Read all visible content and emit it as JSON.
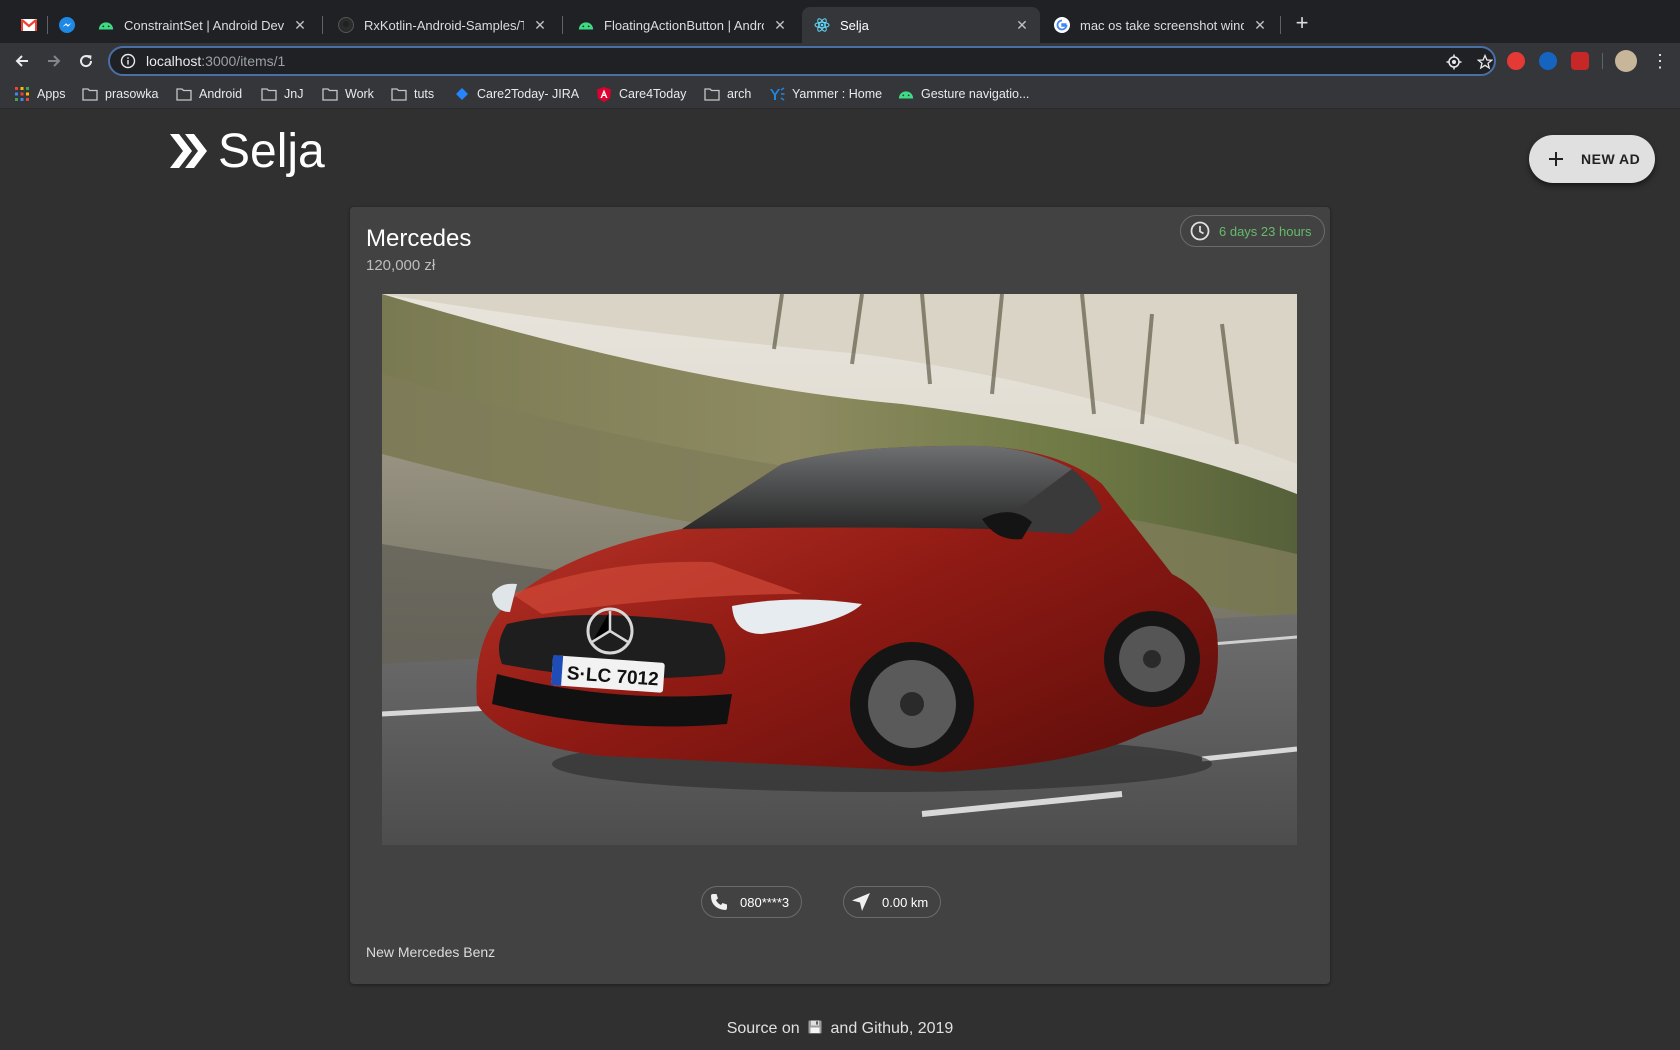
{
  "browser": {
    "tabs": [
      {
        "title": "",
        "icon": "gmail-icon"
      },
      {
        "title": "",
        "icon": "messenger-icon"
      },
      {
        "title": "ConstraintSet  |  Android Devel",
        "icon": "android-icon"
      },
      {
        "title": "RxKotlin-Android-Samples/Tim",
        "icon": "github-icon"
      },
      {
        "title": "FloatingActionButton  |  Androi",
        "icon": "android-icon"
      },
      {
        "title": "Selja",
        "icon": "react-icon",
        "active": true
      },
      {
        "title": "mac os take screenshot window",
        "icon": "google-icon"
      }
    ],
    "url_host": "localhost",
    "url_path": ":3000/items/1",
    "bookmarks": [
      {
        "label": "Apps",
        "icon": "apps-grid-icon"
      },
      {
        "label": "prasowka",
        "icon": "folder-icon"
      },
      {
        "label": "Android",
        "icon": "folder-icon"
      },
      {
        "label": "JnJ",
        "icon": "folder-icon"
      },
      {
        "label": "Work",
        "icon": "folder-icon"
      },
      {
        "label": "tuts",
        "icon": "folder-icon"
      },
      {
        "label": "Care2Today- JIRA",
        "icon": "jira-icon"
      },
      {
        "label": "Care4Today",
        "icon": "angular-icon"
      },
      {
        "label": "arch",
        "icon": "folder-icon"
      },
      {
        "label": "Yammer : Home",
        "icon": "yammer-icon"
      },
      {
        "label": "Gesture navigatio...",
        "icon": "android-icon"
      }
    ]
  },
  "app": {
    "brand": "Selja",
    "fab_label": "NEW AD"
  },
  "item": {
    "title": "Mercedes",
    "price": "120,000 zł",
    "time_left": "6 days 23 hours",
    "photo_plate": "S·LC 7012",
    "phone": "080****3",
    "distance": "0.00 km",
    "description": "New Mercedes Benz"
  },
  "footer": {
    "before": "Source on",
    "after": "and Github, 2019"
  },
  "colors": {
    "background": "#303030",
    "card": "#424242",
    "time_chip_text": "#66bb6a",
    "fab": "#e0e0e0"
  }
}
